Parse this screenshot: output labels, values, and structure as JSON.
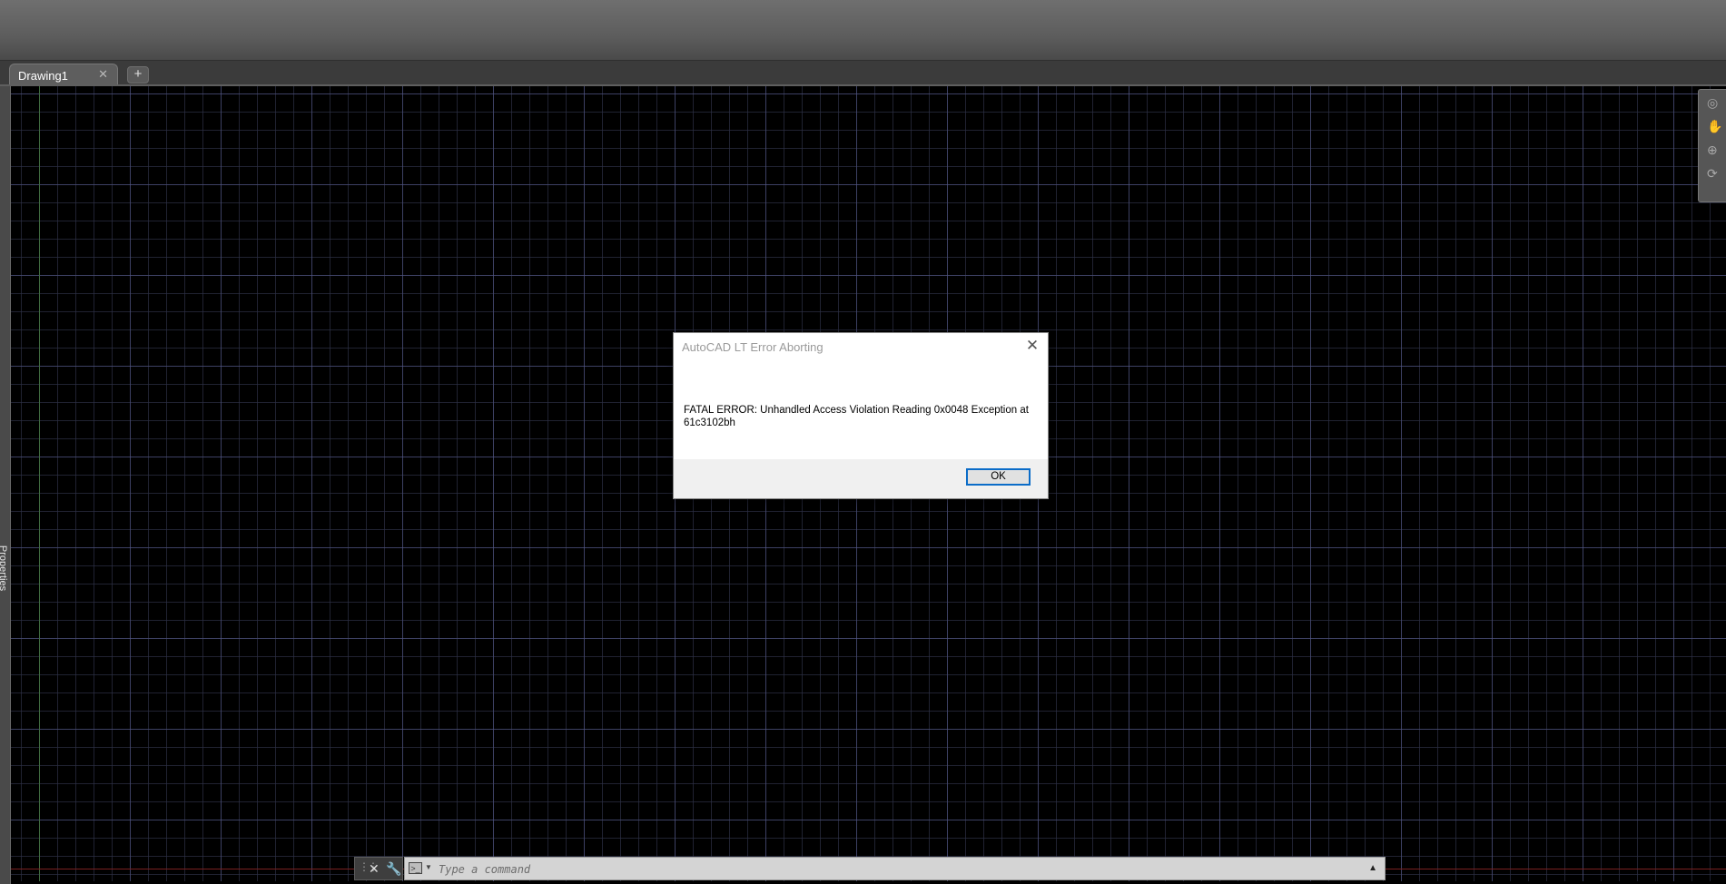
{
  "tabs": {
    "document_tab": "Drawing1",
    "close_glyph": "✕",
    "new_tab_glyph": "+"
  },
  "side_palette": {
    "label": "Properties"
  },
  "dialog": {
    "title": "AutoCAD LT Error Aborting",
    "close_glyph": "✕",
    "message": "FATAL ERROR:  Unhandled Access Violation Reading 0x0048 Exception at 61c3102bh",
    "ok_label": "OK"
  },
  "command_line": {
    "placeholder": "Type a command",
    "close_glyph": "✕",
    "customize_glyph": "🔧",
    "history_glyph": "▲"
  },
  "colors": {
    "canvas_background": "#000000",
    "grid_major": "#555a8c",
    "dialog_button_border": "#0b6cc8"
  },
  "icons": {
    "navbar": [
      "steering-wheel-icon",
      "pan-icon",
      "zoom-icon",
      "orbit-icon"
    ]
  }
}
